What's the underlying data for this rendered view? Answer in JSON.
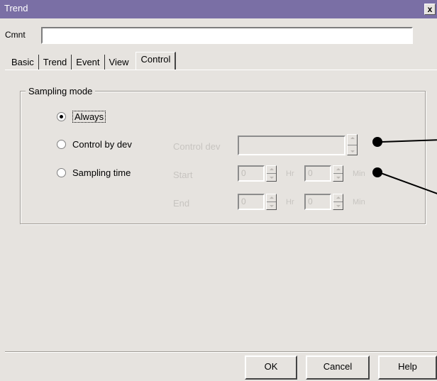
{
  "window": {
    "title": "Trend",
    "close_glyph": "x"
  },
  "comment": {
    "label": "Cmnt",
    "value": ""
  },
  "tabs": [
    {
      "label": "Basic"
    },
    {
      "label": "Trend"
    },
    {
      "label": "Event"
    },
    {
      "label": "View"
    },
    {
      "label": "Control",
      "active": true
    }
  ],
  "sampling": {
    "group_title": "Sampling mode",
    "options": [
      {
        "label": "Always",
        "checked": true
      },
      {
        "label": "Control by dev",
        "checked": false
      },
      {
        "label": "Sampling time",
        "checked": false
      }
    ],
    "control_dev_label": "Control dev",
    "control_dev_value": "",
    "start_label": "Start",
    "end_label": "End",
    "hr_unit": "Hr",
    "min_unit": "Min",
    "start_hr": "0",
    "start_min": "0",
    "end_hr": "0",
    "end_min": "0"
  },
  "buttons": {
    "ok": "OK",
    "cancel": "Cancel",
    "help": "Help"
  },
  "colors": {
    "titlebar": "#7a6fa5",
    "face": "#e6e3df",
    "disabled_text": "#c7c4c0"
  }
}
